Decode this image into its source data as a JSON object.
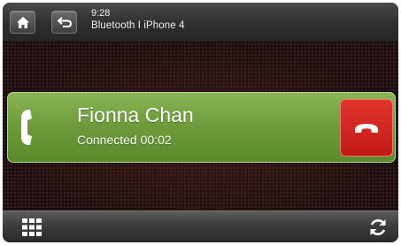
{
  "header": {
    "time": "9:28",
    "source": "Bluetooth I iPhone 4",
    "home_icon": "home-icon",
    "back_icon": "back-icon"
  },
  "call": {
    "caller_name": "Fionna Chan",
    "status": "Connected 00:02",
    "phone_icon": "phone-icon",
    "end_icon": "end-call-icon",
    "bar_color": "#6e9c3c",
    "end_color": "#c21a17"
  },
  "footer": {
    "menu_icon": "grid-menu-icon",
    "refresh_icon": "refresh-icon"
  }
}
